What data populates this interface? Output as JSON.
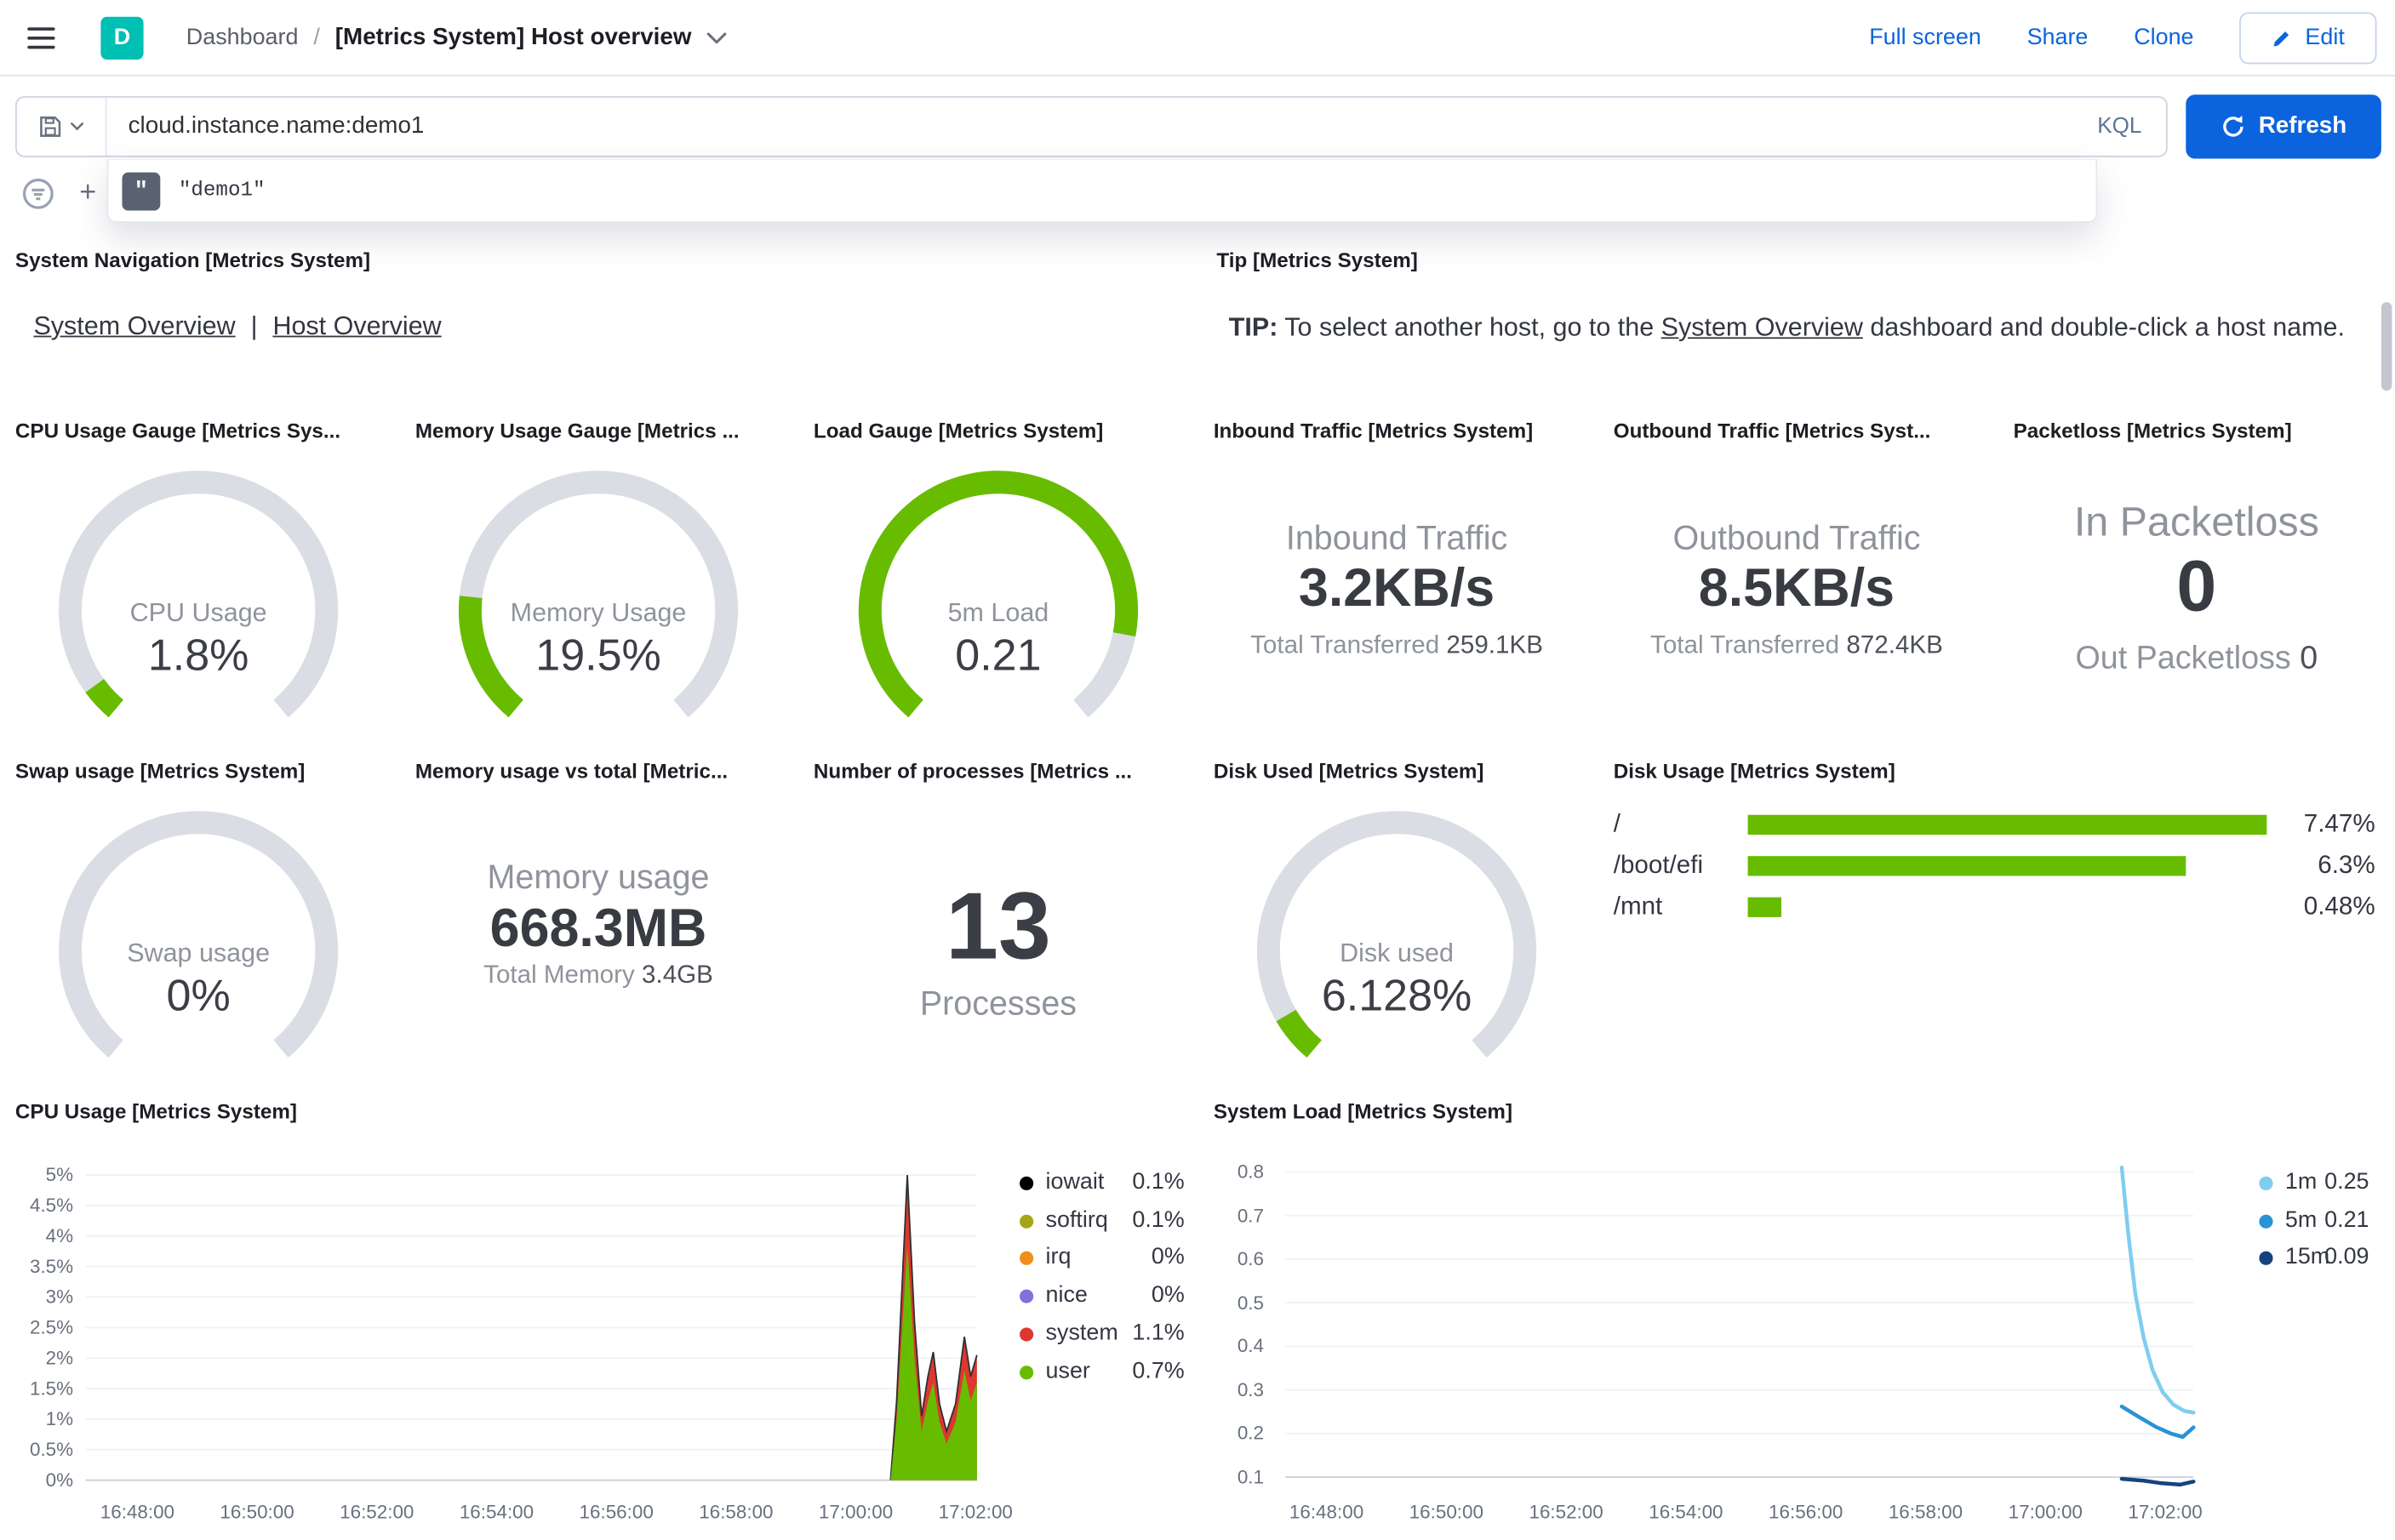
{
  "header": {
    "logo_letter": "D",
    "breadcrumb": {
      "root": "Dashboard",
      "separator": "/",
      "current": "[Metrics System] Host overview"
    },
    "actions": {
      "full_screen": "Full screen",
      "share": "Share",
      "clone": "Clone",
      "edit": "Edit"
    }
  },
  "query_bar": {
    "query": "cloud.instance.name:demo1",
    "language_label": "KQL",
    "refresh_label": "Refresh",
    "add_filter_plus": "+",
    "suggestion": {
      "icon_glyph": "\"",
      "text": "\"demo1\""
    }
  },
  "colors": {
    "accent_blue": "#0b64dd",
    "brand_teal": "#00bfb3",
    "gauge_green": "#68bc00",
    "gauge_track": "#dadde3"
  },
  "panels": {
    "system_navigation": {
      "title": "System Navigation [Metrics System]",
      "link1": "System Overview",
      "separator": "|",
      "link2": "Host Overview"
    },
    "tip": {
      "title": "Tip [Metrics System]",
      "bold": "TIP:",
      "before_link": " To select another host, go to the ",
      "link": "System Overview",
      "after_link": " dashboard and double-click a host name."
    },
    "cpu_gauge": {
      "title": "CPU Usage Gauge [Metrics Sys...",
      "label": "CPU Usage",
      "value": "1.8%",
      "fraction": 0.05,
      "color": "#68bc00"
    },
    "memory_gauge": {
      "title": "Memory Usage Gauge [Metrics ...",
      "label": "Memory Usage",
      "value": "19.5%",
      "fraction": 0.2,
      "color": "#68bc00"
    },
    "load_gauge": {
      "title": "Load Gauge [Metrics System]",
      "label": "5m Load",
      "value": "0.21",
      "fraction": 0.86,
      "color": "#68bc00"
    },
    "inbound_traffic": {
      "title": "Inbound Traffic [Metrics System]",
      "label": "Inbound Traffic",
      "value": "3.2KB/s",
      "total_label": "Total Transferred",
      "total_value": "259.1KB"
    },
    "outbound_traffic": {
      "title": "Outbound Traffic [Metrics Syst...",
      "label": "Outbound Traffic",
      "value": "8.5KB/s",
      "total_label": "Total Transferred",
      "total_value": "872.4KB"
    },
    "packetloss": {
      "title": "Packetloss [Metrics System]",
      "in_label": "In Packetloss",
      "in_value": "0",
      "out_label": "Out Packetloss",
      "out_value": "0"
    },
    "swap_gauge": {
      "title": "Swap usage [Metrics System]",
      "label": "Swap usage",
      "value": "0%",
      "fraction": 0,
      "color": "#68bc00"
    },
    "memory_vs_total": {
      "title": "Memory usage vs total [Metric...",
      "label": "Memory usage",
      "value": "668.3MB",
      "total_label": "Total Memory",
      "total_value": "3.4GB"
    },
    "processes": {
      "title": "Number of processes [Metrics ...",
      "value": "13",
      "label": "Processes"
    },
    "disk_used_gauge": {
      "title": "Disk Used [Metrics System]",
      "label": "Disk used",
      "value": "6.128%",
      "fraction": 0.07,
      "color": "#68bc00"
    },
    "disk_usage": {
      "title": "Disk Usage [Metrics System]",
      "max_pct": 7.47,
      "rows": [
        {
          "label": "/",
          "pct": 7.47,
          "value": "7.47%"
        },
        {
          "label": "/boot/efi",
          "pct": 6.3,
          "value": "6.3%"
        },
        {
          "label": "/mnt",
          "pct": 0.48,
          "value": "0.48%"
        }
      ]
    }
  },
  "chart_data": [
    {
      "type": "area",
      "title": "CPU Usage [Metrics System]",
      "ylim": [
        0,
        5
      ],
      "y_ticks": [
        "5%",
        "4.5%",
        "4%",
        "3.5%",
        "3%",
        "2.5%",
        "2%",
        "1.5%",
        "1%",
        "0.5%",
        "0%"
      ],
      "y_tick_values": [
        5,
        4.5,
        4,
        3.5,
        3,
        2.5,
        2,
        1.5,
        1,
        0.5,
        0
      ],
      "x_ticks": [
        "16:48:00",
        "16:50:00",
        "16:52:00",
        "16:54:00",
        "16:56:00",
        "16:58:00",
        "17:00:00",
        "17:02:00"
      ],
      "legend_position": "right",
      "series": [
        {
          "name": "iowait",
          "legend_value": "0.1%",
          "color": "#000000"
        },
        {
          "name": "softirq",
          "legend_value": "0.1%",
          "color": "#a6a518"
        },
        {
          "name": "irq",
          "legend_value": "0%",
          "color": "#ef8e1b"
        },
        {
          "name": "nice",
          "legend_value": "0%",
          "color": "#8270db"
        },
        {
          "name": "system",
          "legend_value": "1.1%",
          "color": "#de3730",
          "points": [
            [
              0.903,
              0
            ],
            [
              0.91,
              1.3
            ],
            [
              0.922,
              5.0
            ],
            [
              0.93,
              2.6
            ],
            [
              0.938,
              1.05
            ],
            [
              0.945,
              1.7
            ],
            [
              0.951,
              2.1
            ],
            [
              0.958,
              1.25
            ],
            [
              0.966,
              0.8
            ],
            [
              0.976,
              1.25
            ],
            [
              0.986,
              2.35
            ],
            [
              0.993,
              1.7
            ],
            [
              1.0,
              2.05
            ]
          ]
        },
        {
          "name": "user",
          "legend_value": "0.7%",
          "color": "#68bc00",
          "points": [
            [
              0.903,
              0
            ],
            [
              0.91,
              1.0
            ],
            [
              0.922,
              3.85
            ],
            [
              0.93,
              2.0
            ],
            [
              0.938,
              0.8
            ],
            [
              0.945,
              1.3
            ],
            [
              0.951,
              1.6
            ],
            [
              0.958,
              0.95
            ],
            [
              0.966,
              0.6
            ],
            [
              0.976,
              0.95
            ],
            [
              0.986,
              1.8
            ],
            [
              0.993,
              1.3
            ],
            [
              1.0,
              1.6
            ]
          ]
        }
      ]
    },
    {
      "type": "line",
      "title": "System Load [Metrics System]",
      "ylim": [
        0.1,
        0.8
      ],
      "y_ticks": [
        "0.8",
        "0.7",
        "0.6",
        "0.5",
        "0.4",
        "0.3",
        "0.2",
        "0.1"
      ],
      "y_tick_values": [
        0.8,
        0.7,
        0.6,
        0.5,
        0.4,
        0.3,
        0.2,
        0.1
      ],
      "x_ticks": [
        "16:48:00",
        "16:50:00",
        "16:52:00",
        "16:54:00",
        "16:56:00",
        "16:58:00",
        "17:00:00",
        "17:02:00"
      ],
      "legend_position": "right",
      "series": [
        {
          "name": "1m",
          "legend_value": "0.25",
          "color": "#7fcdf0",
          "points": [
            [
              0.921,
              0.81
            ],
            [
              0.928,
              0.66
            ],
            [
              0.936,
              0.52
            ],
            [
              0.945,
              0.42
            ],
            [
              0.955,
              0.345
            ],
            [
              0.966,
              0.295
            ],
            [
              0.978,
              0.266
            ],
            [
              0.99,
              0.252
            ],
            [
              1.0,
              0.248
            ]
          ]
        },
        {
          "name": "5m",
          "legend_value": "0.21",
          "color": "#2a93d5",
          "points": [
            [
              0.921,
              0.262
            ],
            [
              0.94,
              0.238
            ],
            [
              0.958,
              0.216
            ],
            [
              0.975,
              0.2
            ],
            [
              0.988,
              0.192
            ],
            [
              1.0,
              0.214
            ]
          ]
        },
        {
          "name": "15m",
          "legend_value": "0.09",
          "color": "#16437e",
          "points": [
            [
              0.921,
              0.096
            ],
            [
              0.945,
              0.092
            ],
            [
              0.965,
              0.086
            ],
            [
              0.985,
              0.083
            ],
            [
              1.0,
              0.09
            ]
          ]
        }
      ]
    }
  ]
}
